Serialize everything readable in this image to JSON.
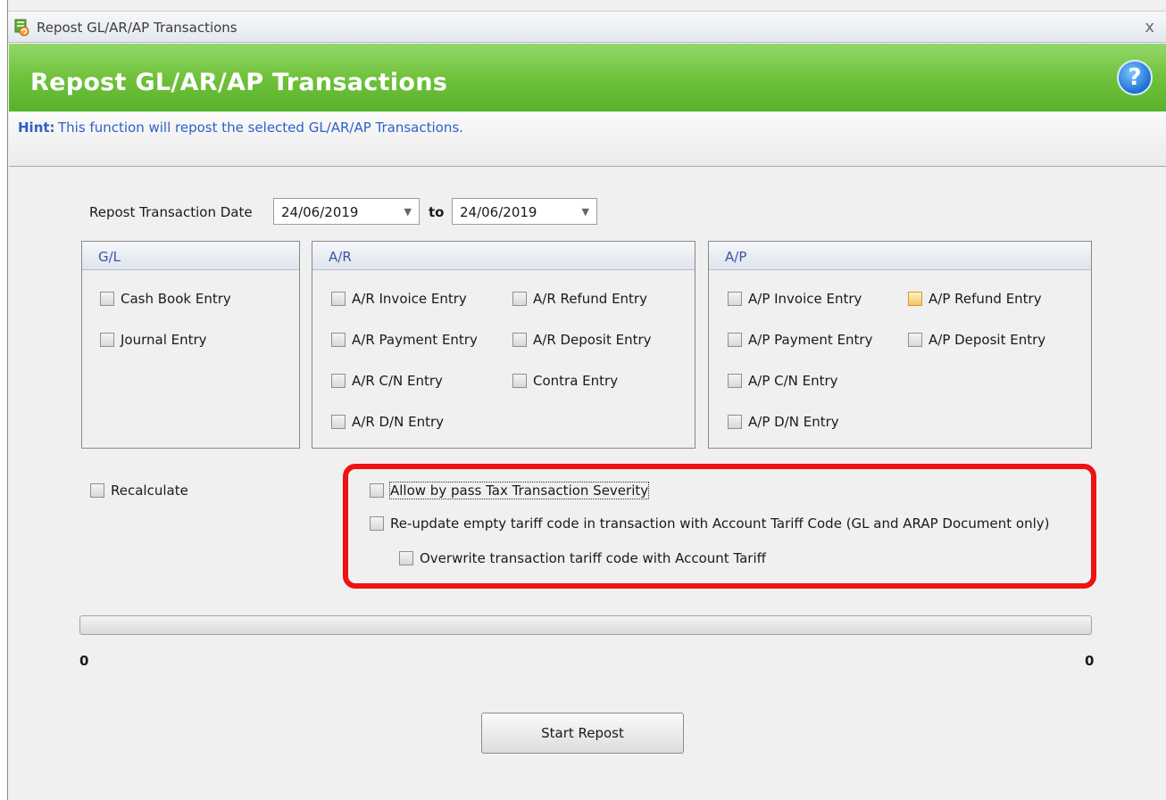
{
  "window": {
    "title": "Repost GL/AR/AP Transactions",
    "close_glyph": "x",
    "icon": "repost-app-icon"
  },
  "banner": {
    "heading": "Repost GL/AR/AP Transactions",
    "help_glyph": "?",
    "color": "#6fc23a"
  },
  "hint": {
    "label": "Hint:",
    "text": "This function will repost the selected GL/AR/AP Transactions.",
    "color": "#2f60c8"
  },
  "dates": {
    "label": "Repost Transaction Date",
    "from": "24/06/2019",
    "to_label": "to",
    "to": "24/06/2019"
  },
  "gl": {
    "title": "G/L",
    "items": [
      {
        "label": "Cash Book Entry",
        "checked": false
      },
      {
        "label": "Journal Entry",
        "checked": false
      }
    ]
  },
  "ar": {
    "title": "A/R",
    "items": [
      {
        "label": "A/R Invoice Entry",
        "checked": false
      },
      {
        "label": "A/R Refund Entry",
        "checked": false
      },
      {
        "label": "A/R Payment Entry",
        "checked": false
      },
      {
        "label": "A/R Deposit Entry",
        "checked": false
      },
      {
        "label": "A/R C/N Entry",
        "checked": false
      },
      {
        "label": "Contra Entry",
        "checked": false
      },
      {
        "label": "A/R D/N Entry",
        "checked": false
      }
    ]
  },
  "ap": {
    "title": "A/P",
    "items": [
      {
        "label": "A/P Invoice Entry",
        "checked": false
      },
      {
        "label": "A/P Refund Entry",
        "checked": false
      },
      {
        "label": "A/P Payment Entry",
        "checked": false
      },
      {
        "label": "A/P Deposit Entry",
        "checked": false
      },
      {
        "label": "A/P C/N Entry",
        "checked": false
      },
      {
        "label": "A/P D/N Entry",
        "checked": false
      }
    ]
  },
  "options": {
    "recalculate": "Recalculate",
    "allow_bypass": "Allow by pass Tax Transaction Severity",
    "reupdate_tariff": "Re-update empty tariff code in transaction with Account Tariff Code (GL and ARAP Document only)",
    "overwrite_tariff": "Overwrite transaction tariff code with Account Tariff"
  },
  "progress": {
    "min": "0",
    "max": "0",
    "value": 0
  },
  "actions": {
    "start_label": "Start Repost"
  },
  "annotation_color": "#ee1212"
}
